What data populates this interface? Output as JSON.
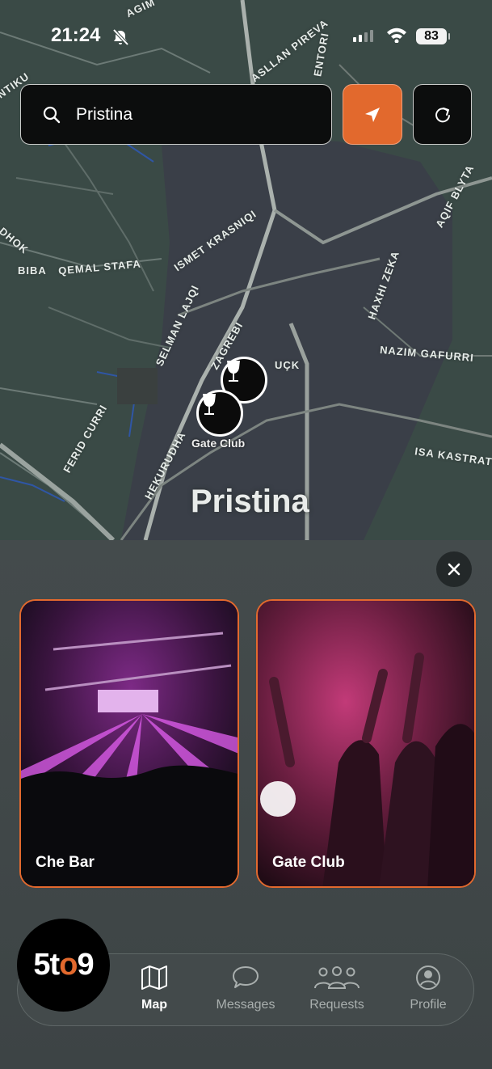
{
  "status_bar": {
    "time": "21:24",
    "battery": "83"
  },
  "search": {
    "value": "Pristina",
    "placeholder": "Search"
  },
  "map": {
    "city": "Pristina",
    "pin_label": "Gate Club",
    "streets": [
      "AGIM",
      "ASLLAN PIREVA",
      "ENTORI",
      "NTIKU",
      "ISMET KRASNIQI",
      "AQIF BLYTA",
      "DHOK",
      "BIBA",
      "QEMAL STAFA",
      "HAXHI ZEKA",
      "SELMAN LAJQI",
      "ZAGREBI",
      "UÇK",
      "NAZIM GAFURRI",
      "FERID CURRI",
      "HEKURUDHA",
      "ISA KASTRAT"
    ]
  },
  "venues": [
    {
      "name": "Che Bar"
    },
    {
      "name": "Gate Club"
    }
  ],
  "nav": {
    "logo_prefix": "5t",
    "logo_o": "o",
    "logo_suffix": "9",
    "items": [
      {
        "label": "Map",
        "icon": "map-icon",
        "active": true
      },
      {
        "label": "Messages",
        "icon": "chat-bubble-icon",
        "active": false
      },
      {
        "label": "Requests",
        "icon": "group-icon",
        "active": false
      },
      {
        "label": "Profile",
        "icon": "user-circle-icon",
        "active": false
      }
    ]
  },
  "colors": {
    "accent": "#e2692d",
    "map_bg": "#3b4a47",
    "sheet_bg": "#444b4c"
  }
}
